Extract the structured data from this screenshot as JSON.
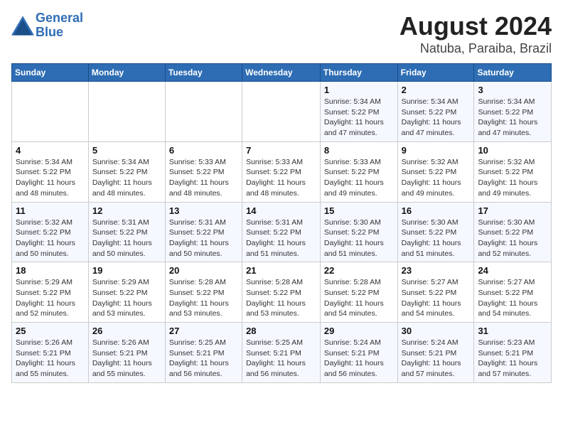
{
  "header": {
    "logo_line1": "General",
    "logo_line2": "Blue",
    "main_title": "August 2024",
    "sub_title": "Natuba, Paraiba, Brazil"
  },
  "calendar": {
    "days_of_week": [
      "Sunday",
      "Monday",
      "Tuesday",
      "Wednesday",
      "Thursday",
      "Friday",
      "Saturday"
    ],
    "weeks": [
      [
        {
          "day": "",
          "info": ""
        },
        {
          "day": "",
          "info": ""
        },
        {
          "day": "",
          "info": ""
        },
        {
          "day": "",
          "info": ""
        },
        {
          "day": "1",
          "info": "Sunrise: 5:34 AM\nSunset: 5:22 PM\nDaylight: 11 hours\nand 47 minutes."
        },
        {
          "day": "2",
          "info": "Sunrise: 5:34 AM\nSunset: 5:22 PM\nDaylight: 11 hours\nand 47 minutes."
        },
        {
          "day": "3",
          "info": "Sunrise: 5:34 AM\nSunset: 5:22 PM\nDaylight: 11 hours\nand 47 minutes."
        }
      ],
      [
        {
          "day": "4",
          "info": "Sunrise: 5:34 AM\nSunset: 5:22 PM\nDaylight: 11 hours\nand 48 minutes."
        },
        {
          "day": "5",
          "info": "Sunrise: 5:34 AM\nSunset: 5:22 PM\nDaylight: 11 hours\nand 48 minutes."
        },
        {
          "day": "6",
          "info": "Sunrise: 5:33 AM\nSunset: 5:22 PM\nDaylight: 11 hours\nand 48 minutes."
        },
        {
          "day": "7",
          "info": "Sunrise: 5:33 AM\nSunset: 5:22 PM\nDaylight: 11 hours\nand 48 minutes."
        },
        {
          "day": "8",
          "info": "Sunrise: 5:33 AM\nSunset: 5:22 PM\nDaylight: 11 hours\nand 49 minutes."
        },
        {
          "day": "9",
          "info": "Sunrise: 5:32 AM\nSunset: 5:22 PM\nDaylight: 11 hours\nand 49 minutes."
        },
        {
          "day": "10",
          "info": "Sunrise: 5:32 AM\nSunset: 5:22 PM\nDaylight: 11 hours\nand 49 minutes."
        }
      ],
      [
        {
          "day": "11",
          "info": "Sunrise: 5:32 AM\nSunset: 5:22 PM\nDaylight: 11 hours\nand 50 minutes."
        },
        {
          "day": "12",
          "info": "Sunrise: 5:31 AM\nSunset: 5:22 PM\nDaylight: 11 hours\nand 50 minutes."
        },
        {
          "day": "13",
          "info": "Sunrise: 5:31 AM\nSunset: 5:22 PM\nDaylight: 11 hours\nand 50 minutes."
        },
        {
          "day": "14",
          "info": "Sunrise: 5:31 AM\nSunset: 5:22 PM\nDaylight: 11 hours\nand 51 minutes."
        },
        {
          "day": "15",
          "info": "Sunrise: 5:30 AM\nSunset: 5:22 PM\nDaylight: 11 hours\nand 51 minutes."
        },
        {
          "day": "16",
          "info": "Sunrise: 5:30 AM\nSunset: 5:22 PM\nDaylight: 11 hours\nand 51 minutes."
        },
        {
          "day": "17",
          "info": "Sunrise: 5:30 AM\nSunset: 5:22 PM\nDaylight: 11 hours\nand 52 minutes."
        }
      ],
      [
        {
          "day": "18",
          "info": "Sunrise: 5:29 AM\nSunset: 5:22 PM\nDaylight: 11 hours\nand 52 minutes."
        },
        {
          "day": "19",
          "info": "Sunrise: 5:29 AM\nSunset: 5:22 PM\nDaylight: 11 hours\nand 53 minutes."
        },
        {
          "day": "20",
          "info": "Sunrise: 5:28 AM\nSunset: 5:22 PM\nDaylight: 11 hours\nand 53 minutes."
        },
        {
          "day": "21",
          "info": "Sunrise: 5:28 AM\nSunset: 5:22 PM\nDaylight: 11 hours\nand 53 minutes."
        },
        {
          "day": "22",
          "info": "Sunrise: 5:28 AM\nSunset: 5:22 PM\nDaylight: 11 hours\nand 54 minutes."
        },
        {
          "day": "23",
          "info": "Sunrise: 5:27 AM\nSunset: 5:22 PM\nDaylight: 11 hours\nand 54 minutes."
        },
        {
          "day": "24",
          "info": "Sunrise: 5:27 AM\nSunset: 5:22 PM\nDaylight: 11 hours\nand 54 minutes."
        }
      ],
      [
        {
          "day": "25",
          "info": "Sunrise: 5:26 AM\nSunset: 5:21 PM\nDaylight: 11 hours\nand 55 minutes."
        },
        {
          "day": "26",
          "info": "Sunrise: 5:26 AM\nSunset: 5:21 PM\nDaylight: 11 hours\nand 55 minutes."
        },
        {
          "day": "27",
          "info": "Sunrise: 5:25 AM\nSunset: 5:21 PM\nDaylight: 11 hours\nand 56 minutes."
        },
        {
          "day": "28",
          "info": "Sunrise: 5:25 AM\nSunset: 5:21 PM\nDaylight: 11 hours\nand 56 minutes."
        },
        {
          "day": "29",
          "info": "Sunrise: 5:24 AM\nSunset: 5:21 PM\nDaylight: 11 hours\nand 56 minutes."
        },
        {
          "day": "30",
          "info": "Sunrise: 5:24 AM\nSunset: 5:21 PM\nDaylight: 11 hours\nand 57 minutes."
        },
        {
          "day": "31",
          "info": "Sunrise: 5:23 AM\nSunset: 5:21 PM\nDaylight: 11 hours\nand 57 minutes."
        }
      ]
    ]
  }
}
